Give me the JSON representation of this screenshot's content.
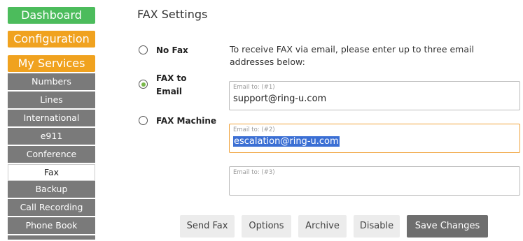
{
  "nav": {
    "dashboard": "Dashboard",
    "configuration": "Configuration",
    "my_services": "My Services",
    "sub_items": [
      "Numbers",
      "Lines",
      "International",
      "e911",
      "Conference",
      "Fax",
      "Backup",
      "Call Recording",
      "Phone Book"
    ],
    "active_item": "Fax",
    "colors": {
      "dashboard": "#4cbc5c",
      "configuration": "#f0a21f",
      "sub_item": "#7a7a7a"
    }
  },
  "main": {
    "title": "FAX Settings",
    "options": [
      {
        "label_line1": "No Fax",
        "label_line2": "",
        "checked": false
      },
      {
        "label_line1": "FAX to",
        "label_line2": "Email",
        "checked": true
      },
      {
        "label_line1": "FAX Machine",
        "label_line2": "",
        "checked": false
      }
    ],
    "info_text": "To receive FAX via email, please enter up to three email addresses below:",
    "email_fields": [
      {
        "label": "Email to: (#1)",
        "value": "support@ring-u.com"
      },
      {
        "label": "Email to: (#2)",
        "value": "escalation@ring-u.com"
      },
      {
        "label": "Email to: (#3)",
        "value": ""
      }
    ],
    "buttons": {
      "send_fax": "Send Fax",
      "options": "Options",
      "archive": "Archive",
      "disable": "Disable",
      "save_changes": "Save Changes"
    }
  }
}
